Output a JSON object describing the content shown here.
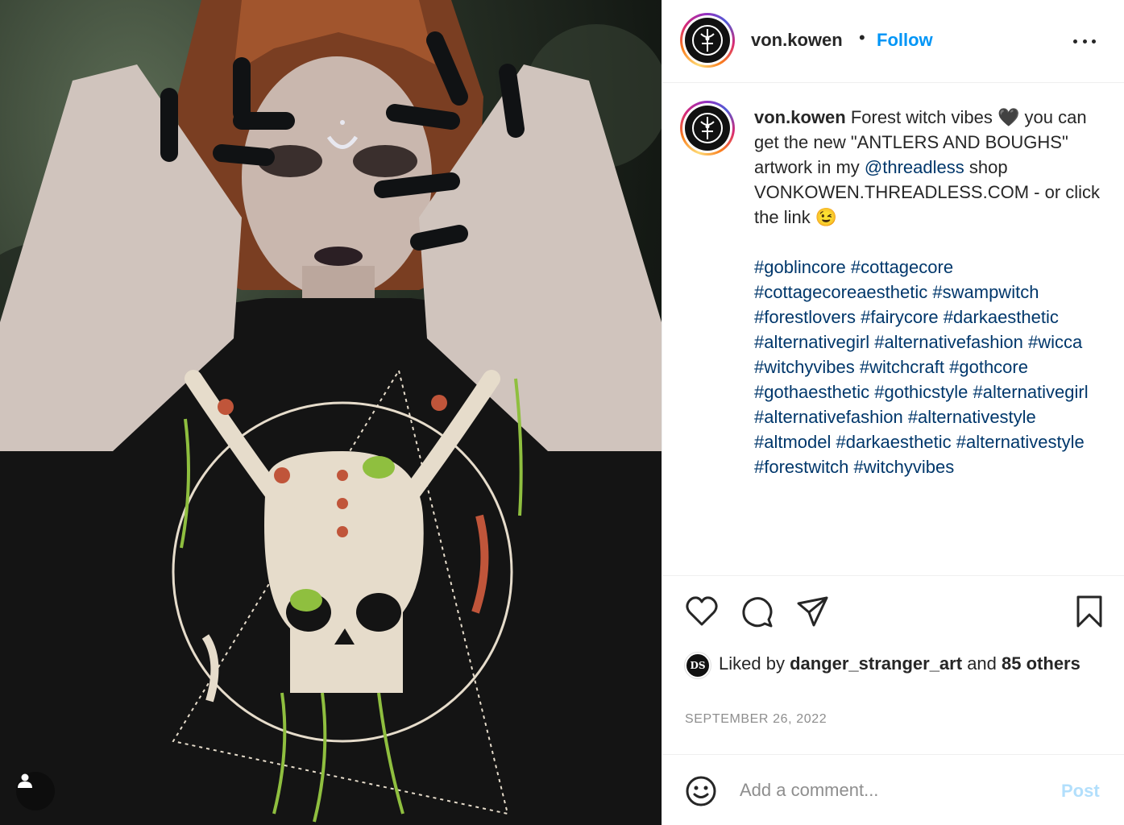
{
  "post": {
    "author": "von.kowen",
    "follow_label": "Follow",
    "separator": "•",
    "more_icon": "more-options-icon"
  },
  "caption": {
    "author": "von.kowen",
    "line1": "Forest witch vibes 🖤",
    "line2": "you can get the new \"ANTLERS AND BOUGHS\" artwork in my",
    "mention": "@threadless",
    "line3": "shop VONKOWEN.THREADLESS.COM - or click the link 😉",
    "hashtags": [
      "#goblincore",
      "#cottagecore",
      "#cottagecoreaesthetic",
      "#swampwitch",
      "#forestlovers",
      "#fairycore",
      "#darkaesthetic",
      "#alternativegirl",
      "#alternativefashion",
      "#wicca",
      "#witchyvibes",
      "#witchcraft",
      "#gothcore",
      "#gothaesthetic",
      "#gothicstyle",
      "#alternativegirl",
      "#alternativefashion",
      "#alternativestyle",
      "#altmodel",
      "#darkaesthetic",
      "#alternativestyle",
      "#forestwitch",
      "#witchyvibes"
    ]
  },
  "actions": {
    "like_icon": "heart-icon",
    "comment_icon": "comment-icon",
    "share_icon": "share-icon",
    "save_icon": "bookmark-icon"
  },
  "likes": {
    "avatar_text": "DS",
    "prefix": "Liked by",
    "user": "danger_stranger_art",
    "middle": "and",
    "count_label": "85 others"
  },
  "date": "SEPTEMBER 26, 2022",
  "comment": {
    "placeholder": "Add a comment...",
    "post_label": "Post"
  },
  "colors": {
    "accent": "#0095f6",
    "link": "#00376b",
    "post_disabled": "#b2dffc",
    "muted": "#8e8e8e"
  }
}
